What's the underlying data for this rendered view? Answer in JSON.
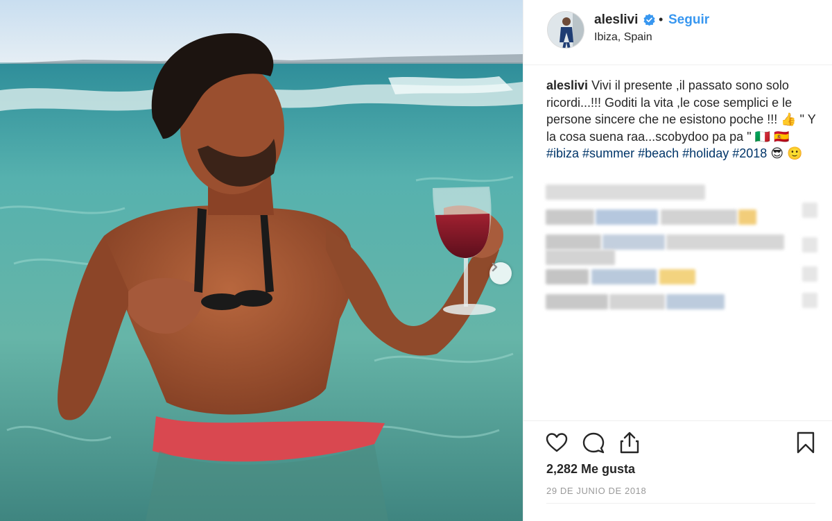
{
  "post": {
    "username": "aleslivi",
    "dot": "•",
    "follow_label": "Seguir",
    "location": "Ibiza, Spain"
  },
  "caption": {
    "username": "aleslivi",
    "text_part1": "Vivi il presente ,il passato sono solo ricordi...!!! Goditi la vita ,le cose semplici e le persone sincere che ne esistono poche !!! 👍 \" Y la cosa suena raa...scobydoo pa pa \" 🇮🇹 🇪🇸",
    "hashtags": [
      "#ibiza",
      "#summer",
      "#beach",
      "#holiday",
      "#2018"
    ],
    "emoji_end": "😎 🙂"
  },
  "actions": {
    "like_icon": "heart-icon",
    "comment_icon": "comment-icon",
    "share_icon": "share-icon",
    "save_icon": "bookmark-icon",
    "likes_label": "2,282 Me gusta",
    "date": "29 DE JUNIO DE 2018"
  },
  "colors": {
    "link": "#3897f0",
    "hashtag": "#003569",
    "verified": "#3897f0"
  }
}
